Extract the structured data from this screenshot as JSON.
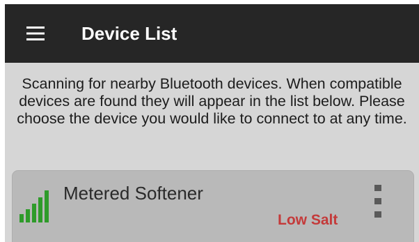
{
  "app_bar": {
    "title": "Device List",
    "menu_icon": "hamburger-menu-icon",
    "background": "#262626"
  },
  "content": {
    "intro_text": "Scanning for nearby Bluetooth devices. When compatible devices are found they will appear in the list below. Please choose the device you would like to connect to at any time.",
    "background": "#d6d6d6"
  },
  "devices": [
    {
      "name": "Metered Softener",
      "status": "Low Salt",
      "signal_bars": 5,
      "signal_icon": "signal-strength-icon",
      "overflow_icon": "more-vert-icon"
    }
  ],
  "colors": {
    "signal_green": "#2e9b2a",
    "status_red": "#c43a3a"
  }
}
